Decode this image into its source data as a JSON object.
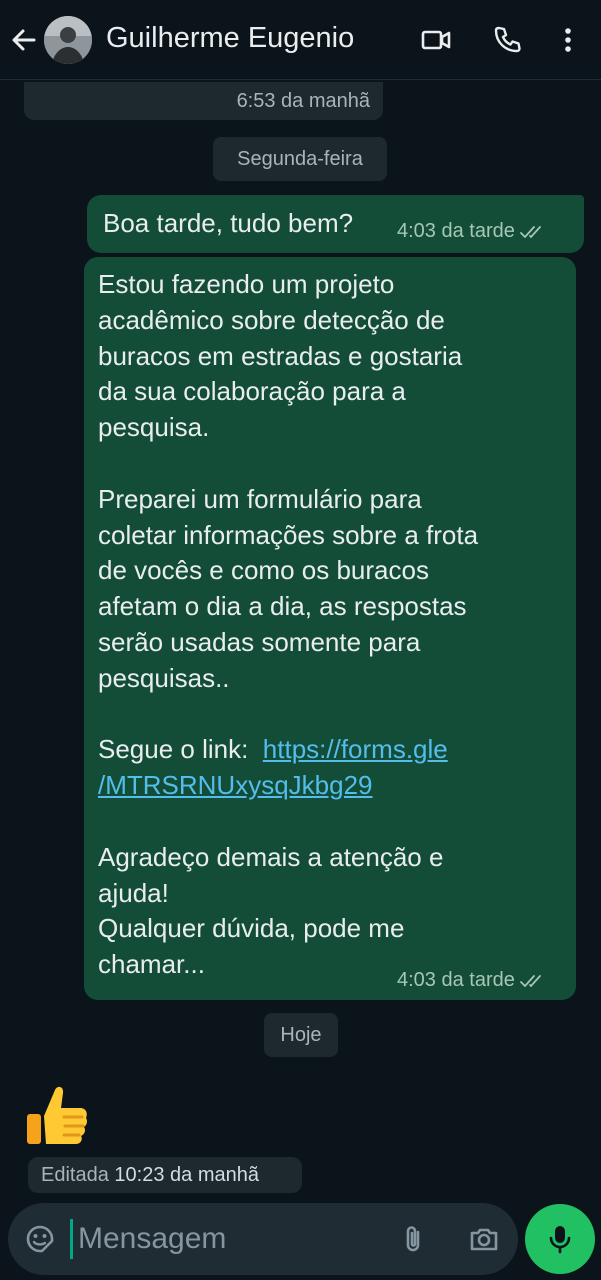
{
  "header": {
    "contact_name": "Guilherme Eugenio"
  },
  "chat": {
    "top_timestamp": "6:53 da manhã",
    "separator_monday": "Segunda-feira",
    "message1": {
      "text": "Boa tarde, tudo bem?",
      "time": "4:03 da tarde"
    },
    "message2": {
      "para1_lines": [
        "Estou fazendo um projeto",
        "acadêmico sobre detecção de",
        "buracos em estradas e gostaria",
        "da sua colaboração para a",
        "pesquisa."
      ],
      "para2_lines": [
        "Preparei um formulário para",
        "coletar informações sobre a frota",
        "de vocês e como os buracos",
        "afetam o dia a dia, as respostas",
        "serão usadas somente para",
        "pesquisas.."
      ],
      "link_prefix": "Segue o link:  ",
      "link_line1": "https://forms.gle",
      "link_line2": "/MTRSRNUxysqJkbg29",
      "para4_lines": [
        "Agradeço demais a atenção e",
        "ajuda!",
        "Qualquer dúvida, pode me",
        "chamar..."
      ],
      "time": "4:03 da tarde"
    },
    "separator_today": "Hoje",
    "reaction_emoji": "thumbs-up",
    "edited_label": "Editada",
    "edited_time": "10:23 da manhã"
  },
  "composer": {
    "placeholder": "Mensagem"
  },
  "icons": {
    "back": "arrow-left-icon",
    "video": "video-call-icon",
    "phone": "phone-icon",
    "menu": "more-vertical-icon",
    "sticker": "sticker-icon",
    "attach": "paperclip-icon",
    "camera": "camera-icon",
    "mic": "microphone-icon"
  },
  "colors": {
    "background": "#0b141a",
    "outgoing_bubble": "#134d37",
    "link": "#53bdeb",
    "mic_button": "#21c063",
    "read_ticks": "#a6c7b6"
  }
}
